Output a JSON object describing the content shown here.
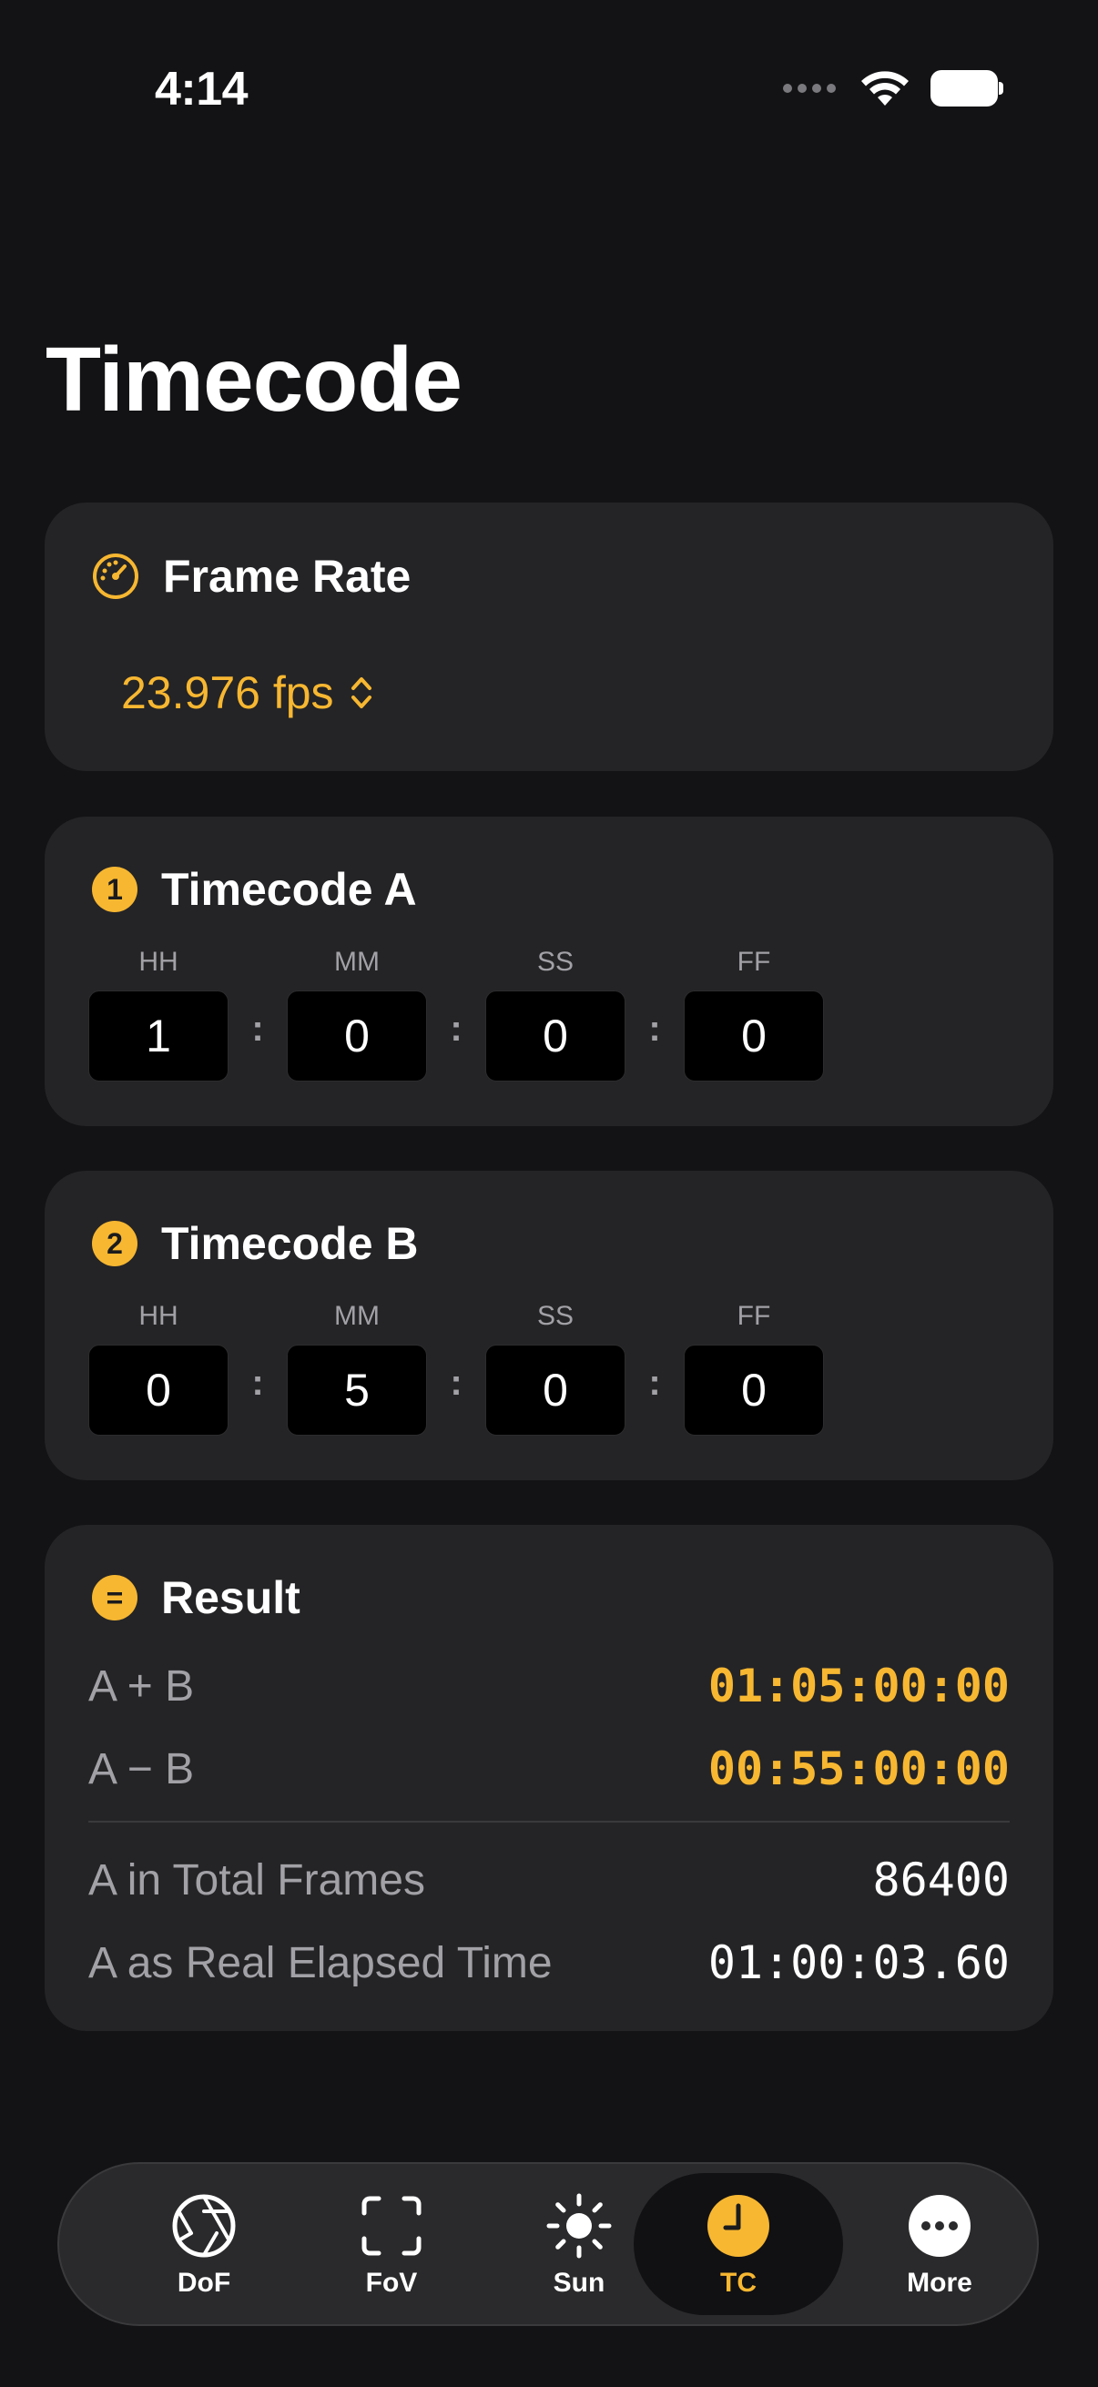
{
  "status_bar": {
    "time": "4:14"
  },
  "page": {
    "title": "Timecode"
  },
  "frame_rate": {
    "title": "Frame Rate",
    "value": "23.976 fps",
    "icon": "gauge-icon"
  },
  "timecode_a": {
    "badge": "1",
    "title": "Timecode A",
    "fields": [
      {
        "label": "HH",
        "value": "1"
      },
      {
        "label": "MM",
        "value": "0"
      },
      {
        "label": "SS",
        "value": "0"
      },
      {
        "label": "FF",
        "value": "0"
      }
    ],
    "separator": ":"
  },
  "timecode_b": {
    "badge": "2",
    "title": "Timecode B",
    "fields": [
      {
        "label": "HH",
        "value": "0"
      },
      {
        "label": "MM",
        "value": "5"
      },
      {
        "label": "SS",
        "value": "0"
      },
      {
        "label": "FF",
        "value": "0"
      }
    ],
    "separator": ":"
  },
  "result": {
    "badge": "=",
    "title": "Result",
    "rows": [
      {
        "label": "A + B",
        "value": "01:05:00:00"
      },
      {
        "label": "A − B",
        "value": "00:55:00:00"
      },
      {
        "label": "A in Total Frames",
        "value": "86400"
      },
      {
        "label": "A as Real Elapsed Time",
        "value": "01:00:03.60"
      }
    ]
  },
  "tab_bar": {
    "tabs": [
      {
        "label": "DoF",
        "icon": "aperture-icon",
        "active": false
      },
      {
        "label": "FoV",
        "icon": "viewfinder-icon",
        "active": false
      },
      {
        "label": "Sun",
        "icon": "sun-icon",
        "active": false
      },
      {
        "label": "TC",
        "icon": "clock-icon",
        "active": true
      },
      {
        "label": "More",
        "icon": "ellipsis-icon",
        "active": false
      }
    ]
  },
  "colors": {
    "background": "#131315",
    "card": "#242426",
    "accent": "#f7b731",
    "secondary_text": "#a1a1a6"
  }
}
